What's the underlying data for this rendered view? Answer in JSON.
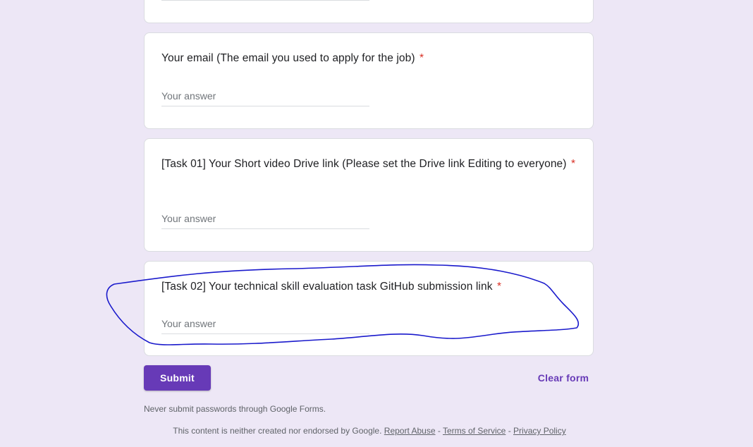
{
  "form": {
    "answer_placeholder": "Your answer",
    "required_mark": "*",
    "questions": [
      {
        "title": "Your email (The email you used to apply for the job)",
        "required": true
      },
      {
        "title": "[Task 01] Your Short video Drive link (Please set the Drive link Editing to everyone)",
        "required": true
      },
      {
        "title": "[Task 02] Your technical skill evaluation task GitHub submission link",
        "required": true
      }
    ]
  },
  "actions": {
    "submit_label": "Submit",
    "clear_label": "Clear form"
  },
  "notice": "Never submit passwords through Google Forms.",
  "footer": {
    "disclaimer": "This content is neither created nor endorsed by Google.",
    "report_abuse": "Report Abuse",
    "separator": "-",
    "terms": "Terms of Service",
    "privacy": "Privacy Policy"
  },
  "colors": {
    "background": "#ede7f6",
    "accent": "#673ab7",
    "required": "#d93025",
    "annotation": "#1a1acc"
  }
}
